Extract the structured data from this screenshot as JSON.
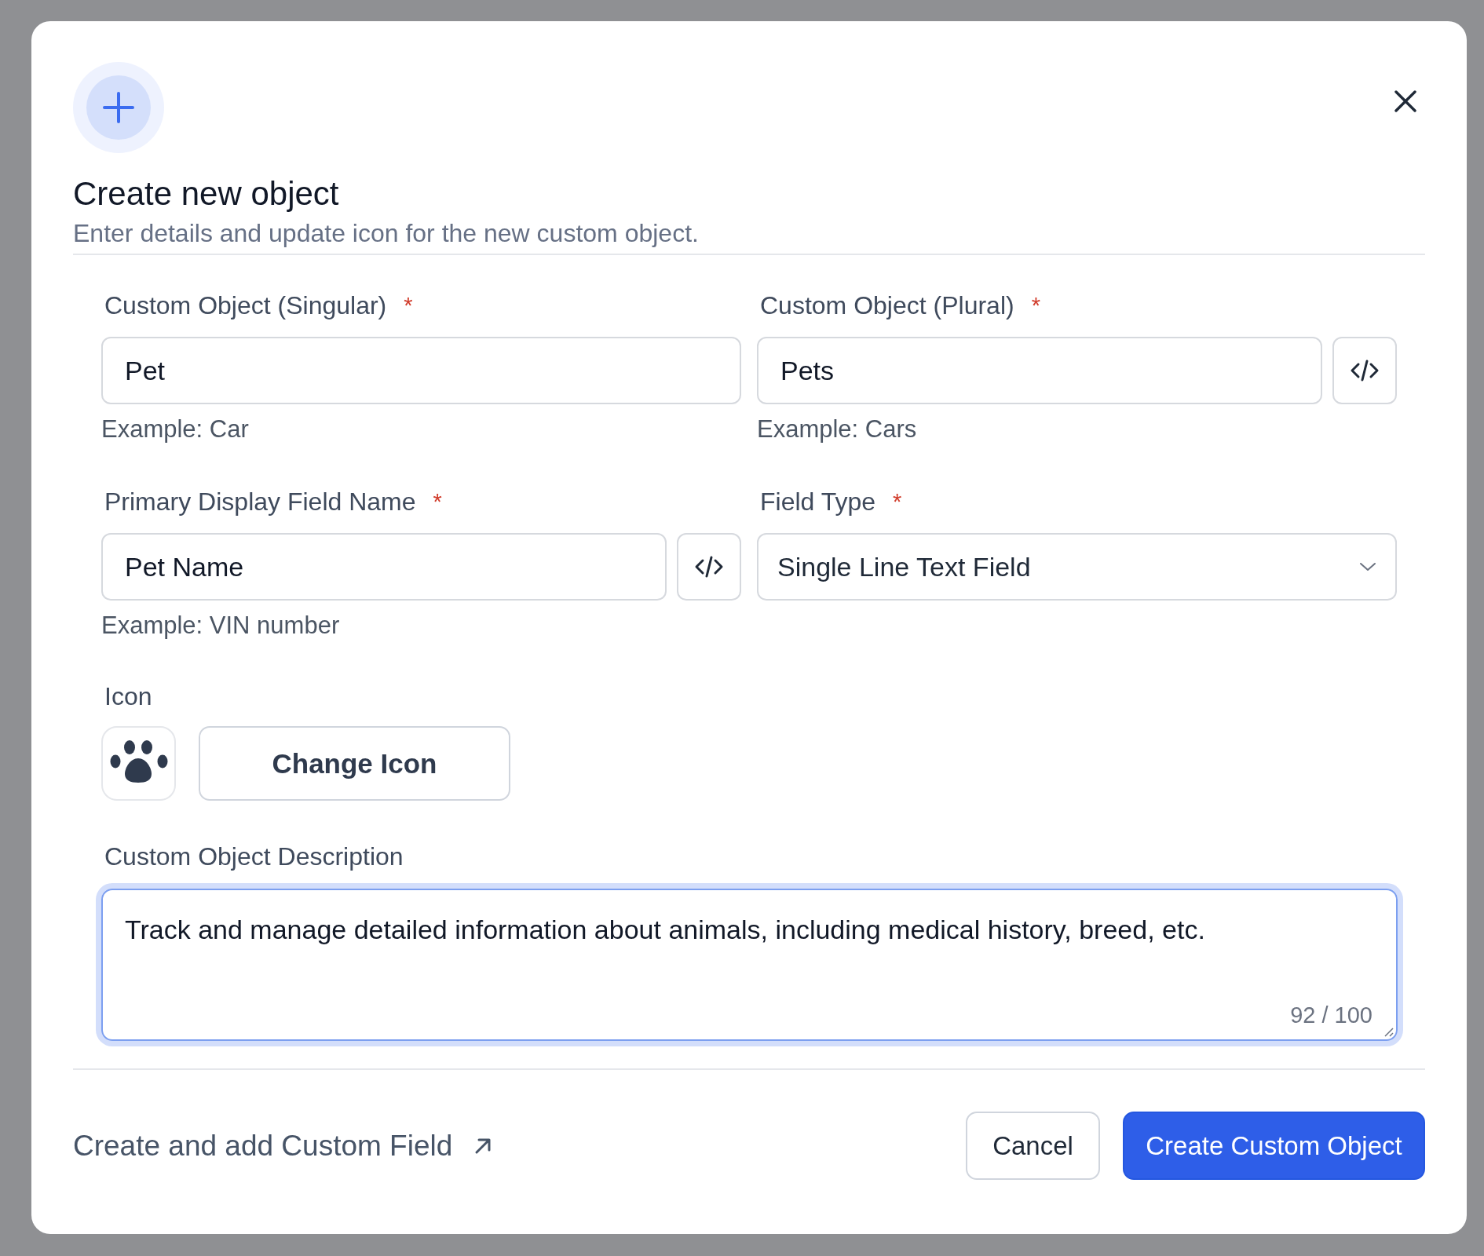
{
  "dialog": {
    "title": "Create new object",
    "subtitle": "Enter details and update icon for the new custom object.",
    "fields": [
      {
        "kind": "text",
        "label": "Custom Object (Singular)",
        "required_mark": "*",
        "value": "Pet",
        "hint": "Example: Car"
      },
      {
        "kind": "text_with_code",
        "label": "Custom Object (Plural)",
        "required_mark": "*",
        "value": "Pets",
        "hint": "Example: Cars"
      },
      {
        "kind": "text_with_code",
        "label": "Primary Display Field Name",
        "required_mark": "*",
        "value": "Pet Name",
        "hint": "Example: VIN number"
      },
      {
        "kind": "select",
        "label": "Field Type",
        "required_mark": "*",
        "value": "Single Line Text Field"
      }
    ],
    "icon": {
      "label": "Icon",
      "button": "Change Icon"
    },
    "description": {
      "label": "Custom Object Description",
      "value": "Track and manage detailed information about animals, including medical history, breed, etc.",
      "counter": "92 / 100",
      "focused": true
    },
    "footer": {
      "link": "Create and add Custom Field",
      "cancel": "Cancel",
      "submit": "Create Custom Object"
    }
  }
}
